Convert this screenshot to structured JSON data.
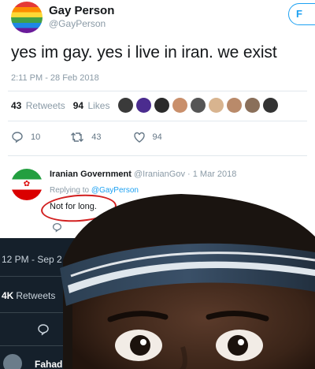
{
  "tweet": {
    "name": "Gay Person",
    "handle": "@GayPerson",
    "follow_label": "F",
    "text": "yes im gay. yes i live in iran. we exist",
    "timestamp": "2:11 PM - 28 Feb 2018",
    "retweets_count": "43",
    "retweets_label": "Retweets",
    "likes_count": "94",
    "likes_label": "Likes",
    "reply_count": "10",
    "retweet_count": "43",
    "like_count": "94",
    "liker_colors": [
      "#3a3a3a",
      "#4b2c8f",
      "#2a2a2a",
      "#c98f6b",
      "#555555",
      "#d8b48f",
      "#b98a6a",
      "#8a6f5a",
      "#333333"
    ]
  },
  "reply": {
    "name": "Iranian Government",
    "handle": "@IranianGov",
    "date": "· 1 Mar 2018",
    "replying_prefix": "Replying to",
    "replying_to": "@GayPerson",
    "text": "Not for long."
  },
  "dark_overlay": {
    "time": "12 PM - Sep 2",
    "retweets_count": "4K",
    "retweets_label": "Retweets",
    "user_name": "Fahad"
  },
  "colors": {
    "twitter_blue": "#1da1f2",
    "annotation_red": "#d22020",
    "dark_bg": "#15202b"
  }
}
